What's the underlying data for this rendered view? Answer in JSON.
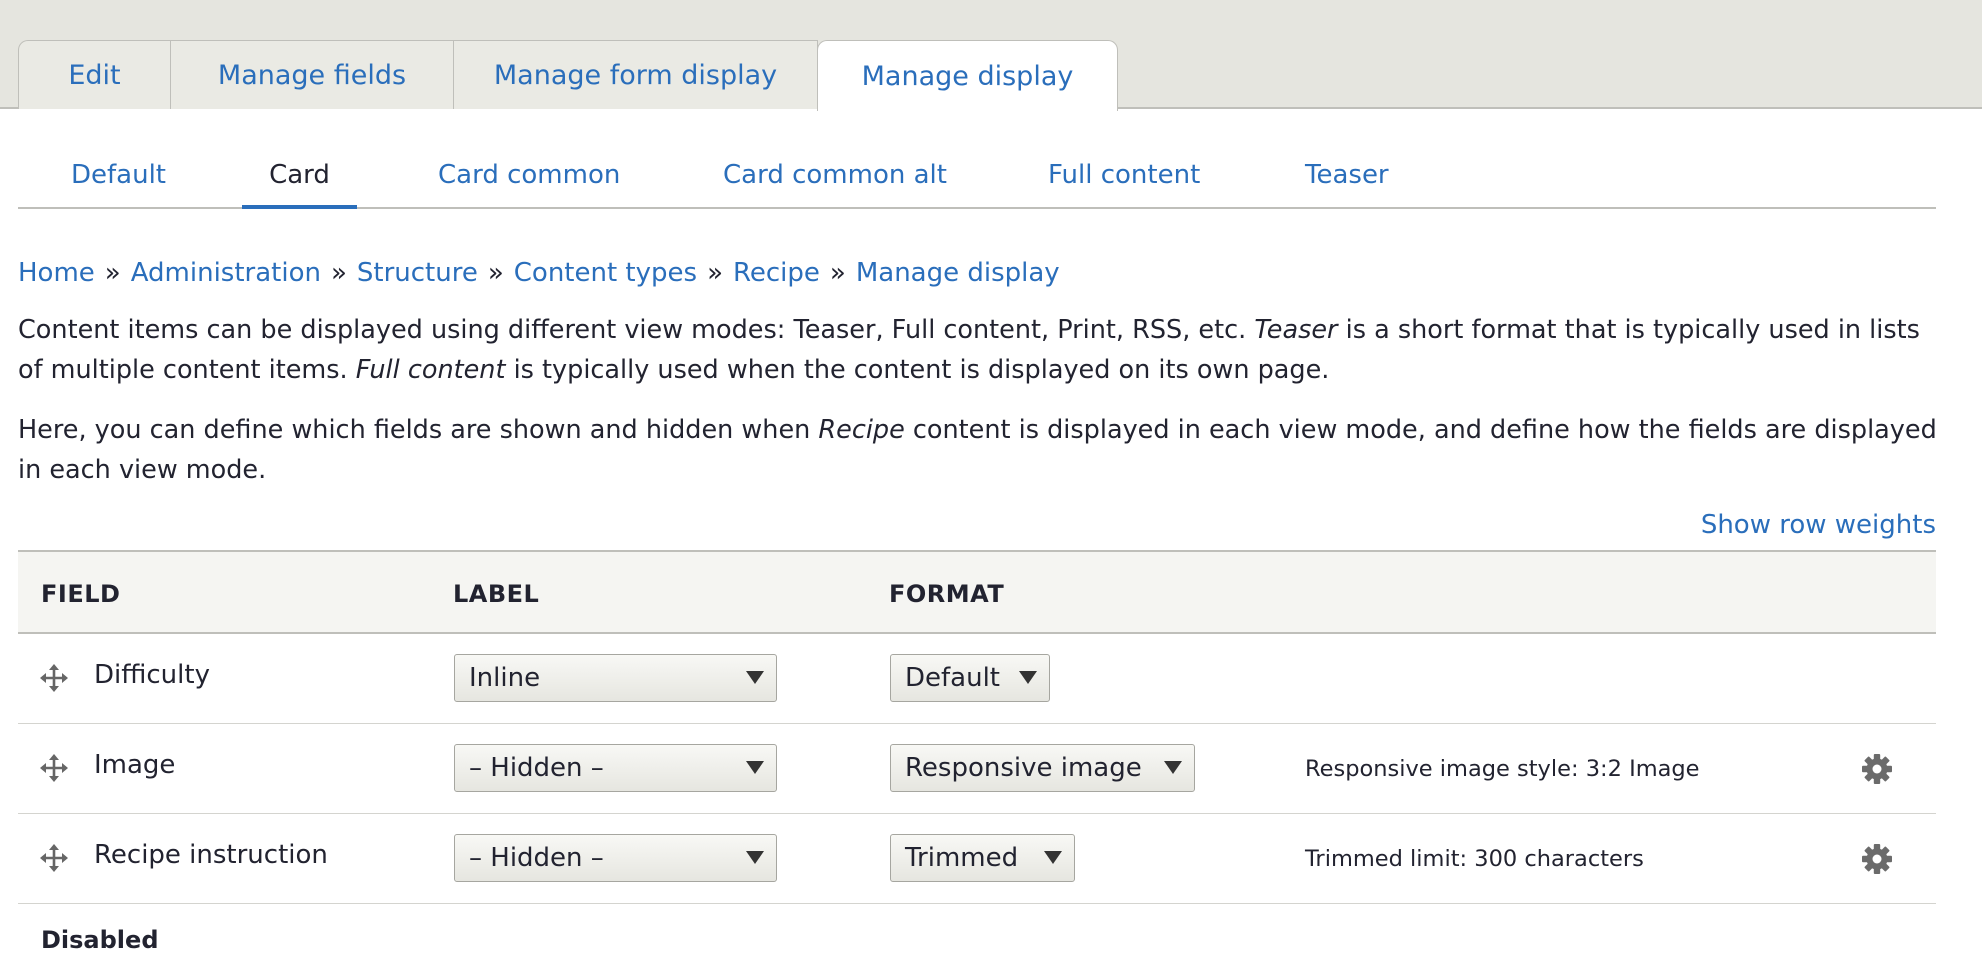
{
  "primary_tabs": [
    "Edit",
    "Manage fields",
    "Manage form display",
    "Manage display"
  ],
  "secondary_tabs": [
    "Default",
    "Card",
    "Card common",
    "Card common alt",
    "Full content",
    "Teaser"
  ],
  "breadcrumb": [
    "Home",
    "Administration",
    "Structure",
    "Content types",
    "Recipe",
    "Manage display"
  ],
  "breadcrumb_separator": "»",
  "description": {
    "p1_a": "Content items can be displayed using different view modes: Teaser, Full content, Print, RSS, etc. ",
    "p1_em1": "Teaser",
    "p1_b": " is a short format that is typically used in lists of multiple content items. ",
    "p1_em2": "Full content",
    "p1_c": " is typically used when the content is displayed on its own page.",
    "p2_a": "Here, you can define which fields are shown and hidden when ",
    "p2_em": "Recipe",
    "p2_b": " content is displayed in each view mode, and define how the fields are displayed in each view mode."
  },
  "show_row_weights": "Show row weights",
  "table": {
    "headers": [
      "FIELD",
      "LABEL",
      "FORMAT"
    ],
    "rows": [
      {
        "field": "Difficulty",
        "label": "Inline",
        "format": "Default",
        "summary": ""
      },
      {
        "field": "Image",
        "label": "– Hidden –",
        "format": "Responsive image",
        "summary": "Responsive image style: 3:2 Image"
      },
      {
        "field": "Recipe instruction",
        "label": "– Hidden –",
        "format": "Trimmed",
        "summary": "Trimmed limit: 300 characters"
      }
    ]
  },
  "disabled_heading": "Disabled",
  "icons": {
    "drag": "drag-handle-icon",
    "settings": "gear-icon"
  },
  "colors": {
    "link": "#2a6ebb",
    "tab_bar": "#e5e5df",
    "table_header": "#f5f5f2"
  }
}
